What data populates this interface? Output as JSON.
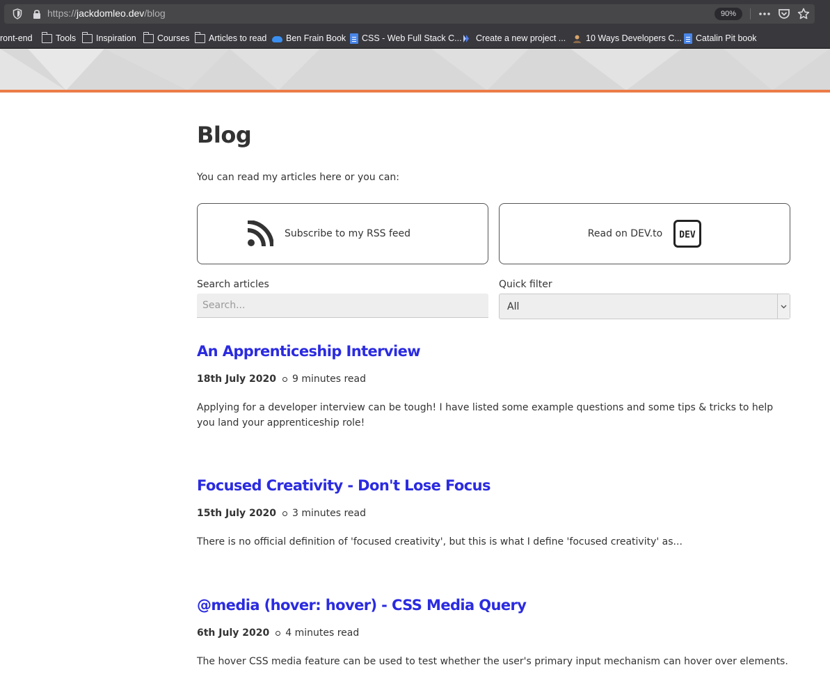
{
  "browser": {
    "url_scheme": "https://",
    "url_host": "jackdomleo.dev",
    "url_path": "/blog",
    "zoom": "90%",
    "bookmarks": [
      {
        "label": "ront-end",
        "icon": "folder-icon"
      },
      {
        "label": "Tools",
        "icon": "folder-icon"
      },
      {
        "label": "Inspiration",
        "icon": "folder-icon"
      },
      {
        "label": "Courses",
        "icon": "folder-icon"
      },
      {
        "label": "Articles to read",
        "icon": "folder-icon"
      },
      {
        "label": "Ben Frain Book",
        "icon": "cloud-icon"
      },
      {
        "label": "CSS - Web Full Stack C...",
        "icon": "doc-icon"
      },
      {
        "label": "Create a new project ...",
        "icon": "site-icon"
      },
      {
        "label": "10 Ways Developers C...",
        "icon": "avatar-icon"
      },
      {
        "label": "Catalin Pit book",
        "icon": "doc-icon"
      }
    ]
  },
  "page": {
    "title": "Blog",
    "intro": "You can read my articles here or you can:",
    "rss_label": "Subscribe to my RSS feed",
    "dev_label": "Read on DEV.to",
    "dev_badge": "DEV",
    "search_label": "Search articles",
    "search_placeholder": "Search...",
    "filter_label": "Quick filter",
    "filter_value": "All",
    "accent_color": "#ec7c47",
    "link_color": "#2b2be0"
  },
  "posts": [
    {
      "title": "An Apprenticeship Interview",
      "date": "18th July 2020",
      "read_time": "9 minutes read",
      "excerpt": "Applying for a developer interview can be tough! I have listed some example questions and some tips & tricks to help you land your apprenticeship role!"
    },
    {
      "title": "Focused Creativity - Don't Lose Focus",
      "date": "15th July 2020",
      "read_time": "3 minutes read",
      "excerpt": "There is no official definition of 'focused creativity', but this is what I define 'focused creativity' as..."
    },
    {
      "title": "@media (hover: hover) - CSS Media Query",
      "date": "6th July 2020",
      "read_time": "4 minutes read",
      "excerpt": "The hover CSS media feature can be used to test whether the user's primary input mechanism can hover over elements."
    }
  ]
}
